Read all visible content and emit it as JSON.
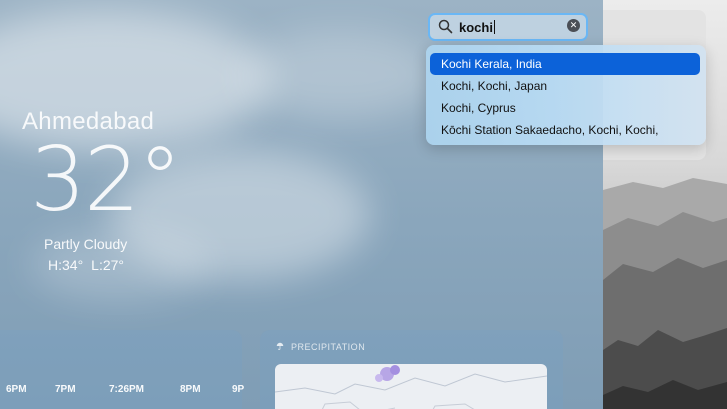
{
  "weather": {
    "city": "Ahmedabad",
    "temperature": "32°",
    "condition": "Partly Cloudy",
    "high": "H:34°",
    "low": "L:27°"
  },
  "hourly": {
    "labels": [
      {
        "text": "6PM"
      },
      {
        "text": "7PM"
      },
      {
        "text": "7:26PM"
      },
      {
        "text": "8PM"
      },
      {
        "text": "9P"
      }
    ]
  },
  "precipitation": {
    "title": "PRECIPITATION",
    "icon": "umbrella-icon"
  },
  "search": {
    "query": "kochi",
    "icon": "search-icon",
    "clear_icon": "clear-icon"
  },
  "suggestions": [
    {
      "label": "Kochi Kerala, India",
      "selected": true
    },
    {
      "label": "Kochi, Kochi, Japan",
      "selected": false
    },
    {
      "label": "Kochi, Cyprus",
      "selected": false
    },
    {
      "label": "Kōchi Station Sakaedacho, Kochi, Kochi,",
      "selected": false
    }
  ],
  "colors": {
    "accent": "#0c62d9",
    "search_border": "#6ab7f5"
  }
}
